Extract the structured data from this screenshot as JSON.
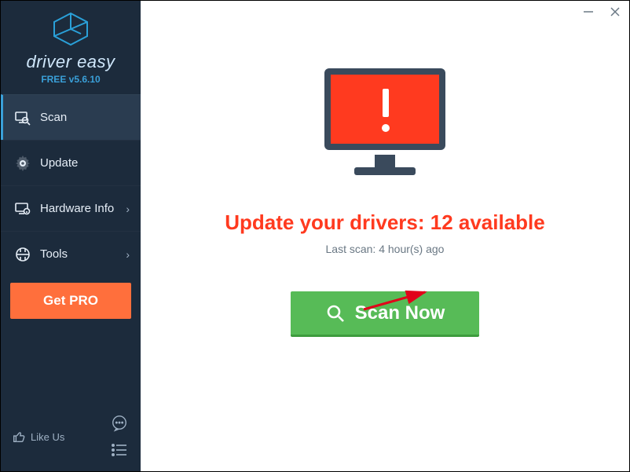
{
  "brand": {
    "name": "driver easy",
    "version_label": "FREE v5.6.10"
  },
  "sidebar": {
    "items": [
      {
        "label": "Scan"
      },
      {
        "label": "Update"
      },
      {
        "label": "Hardware Info"
      },
      {
        "label": "Tools"
      }
    ],
    "getpro_label": "Get PRO",
    "likeus_label": "Like Us"
  },
  "main": {
    "headline": "Update your drivers: 12 available",
    "subline": "Last scan: 4 hour(s) ago",
    "scan_label": "Scan Now"
  },
  "status": {
    "outdated_drivers": 12,
    "last_scan_hours": 4
  }
}
